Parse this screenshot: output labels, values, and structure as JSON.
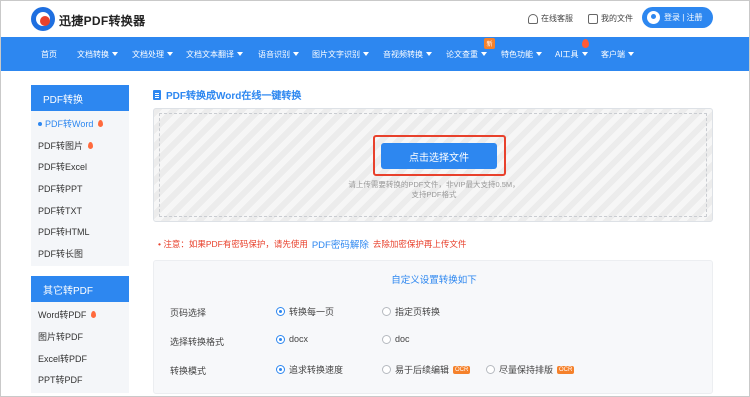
{
  "header": {
    "brand": "迅捷PDF转换器",
    "service_link": "在线客服",
    "docs_link": "我的文件",
    "login_label": "登录 | 注册"
  },
  "nav": {
    "items": [
      {
        "label": "首页",
        "caret": false
      },
      {
        "label": "文档转换",
        "caret": true
      },
      {
        "label": "文档处理",
        "caret": true
      },
      {
        "label": "文档文本翻译",
        "caret": true
      },
      {
        "label": "语音识别",
        "caret": true
      },
      {
        "label": "图片文字识别",
        "caret": true
      },
      {
        "label": "音视频转换",
        "caret": true
      },
      {
        "label": "论文查重",
        "caret": true
      },
      {
        "label": "特色功能",
        "caret": true
      },
      {
        "label": "AI工具",
        "caret": true
      },
      {
        "label": "客户端",
        "caret": true
      }
    ],
    "new_badge": "新"
  },
  "sidebar": {
    "section1_title": "PDF转换",
    "section1_items": [
      "PDF转Word",
      "PDF转图片",
      "PDF转Excel",
      "PDF转PPT",
      "PDF转TXT",
      "PDF转HTML",
      "PDF转长图"
    ],
    "section2_title": "其它转PDF",
    "section2_items": [
      "Word转PDF",
      "图片转PDF",
      "Excel转PDF",
      "PPT转PDF"
    ]
  },
  "main": {
    "page_title": "PDF转换成Word在线一键转换",
    "choose_button": "点击选择文件",
    "hint_line1": "请上传需要转换的PDF文件，非VIP最大支持0.5M，",
    "hint_line2": "支持PDF格式",
    "notice_prefix": "•  注意：如果PDF有密码保护，请先使用",
    "notice_link": "PDF密码解除",
    "notice_suffix": "去除加密保护再上传文件"
  },
  "settings": {
    "title": "自定义设置转换如下",
    "rows": [
      {
        "label": "页码选择",
        "options": [
          "转换每一页",
          "指定页转换"
        ],
        "selected": 0
      },
      {
        "label": "选择转换格式",
        "options": [
          "docx",
          "doc"
        ],
        "selected": 0
      },
      {
        "label": "转换模式",
        "options": [
          "追求转换速度",
          "易于后续编辑",
          "尽量保持排版"
        ],
        "selected": 0
      }
    ],
    "ocr_badge": "OCR"
  },
  "colors": {
    "accent": "#2d87f0",
    "highlight_border": "#e8412c",
    "badge_orange": "#f5812b"
  }
}
